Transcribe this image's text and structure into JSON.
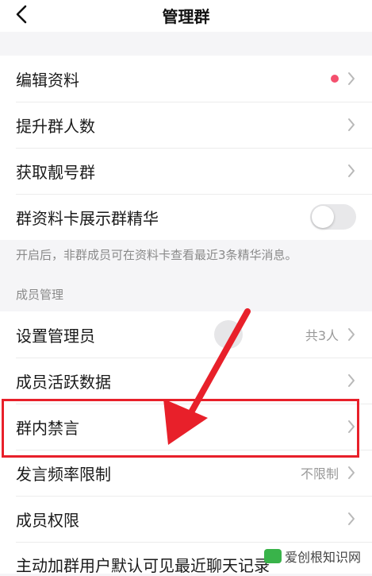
{
  "nav": {
    "title": "管理群"
  },
  "rows_top": [
    {
      "label": "编辑资料",
      "has_dot": true
    },
    {
      "label": "提升群人数"
    },
    {
      "label": "获取靓号群"
    },
    {
      "label": "群资料卡展示群精华",
      "toggle": false
    }
  ],
  "hint": "开启后，非群成员可在资料卡查看最近3条精华消息。",
  "section_member": "成员管理",
  "rows_member": [
    {
      "label": "设置管理员",
      "value": "共3人"
    },
    {
      "label": "成员活跃数据"
    },
    {
      "label": "群内禁言"
    },
    {
      "label": "发言频率限制",
      "value": "不限制"
    },
    {
      "label": "成员权限"
    },
    {
      "label": "主动加群用户默认可见最近聊天记录"
    }
  ],
  "watermark": "爱创根知识网",
  "colors": {
    "red_dot": "#f4506e",
    "highlight": "#e8202a"
  }
}
